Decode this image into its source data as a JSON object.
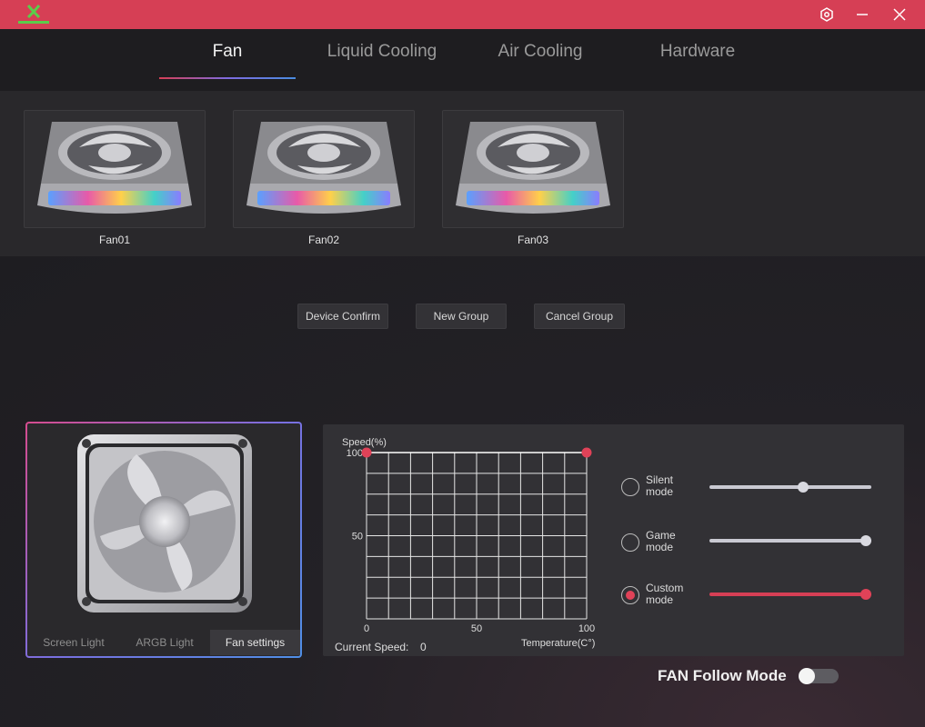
{
  "tabs": [
    {
      "label": "Fan",
      "active": true
    },
    {
      "label": "Liquid Cooling",
      "active": false
    },
    {
      "label": "Air Cooling",
      "active": false
    },
    {
      "label": "Hardware",
      "active": false
    }
  ],
  "devices": [
    {
      "label": "Fan01"
    },
    {
      "label": "Fan02"
    },
    {
      "label": "Fan03"
    }
  ],
  "buttons": {
    "device_confirm": "Device Confirm",
    "new_group": "New Group",
    "cancel_group": "Cancel Group"
  },
  "preview_tabs": [
    {
      "label": "Screen Light",
      "active": false
    },
    {
      "label": "ARGB Light",
      "active": false
    },
    {
      "label": "Fan settings",
      "active": true
    }
  ],
  "chart_data": {
    "type": "line",
    "ylabel": "Speed(%)",
    "xlabel": "Temperature(C°)",
    "x_ticks": [
      "0",
      "50",
      "100"
    ],
    "y_ticks": [
      "100",
      "50"
    ],
    "xlim": [
      0,
      100
    ],
    "ylim": [
      0,
      100
    ],
    "grid": true,
    "series": [
      {
        "points": [
          {
            "x": 0,
            "y": 100
          },
          {
            "x": 100,
            "y": 100
          }
        ]
      }
    ]
  },
  "current_speed": {
    "label": "Current Speed:",
    "value": "0"
  },
  "modes": [
    {
      "name": "Silent mode",
      "line1": "Silent",
      "line2": "mode",
      "checked": false,
      "level": 0.6
    },
    {
      "name": "Game mode",
      "line1": "Game",
      "line2": "mode",
      "checked": false,
      "level": 1.0
    },
    {
      "name": "Custom mode",
      "line1": "Custom",
      "line2": "mode",
      "checked": true,
      "level": 1.0
    }
  ],
  "fan_follow": {
    "label": "FAN Follow Mode",
    "enabled": false
  },
  "colors": {
    "accent": "#d63f55",
    "title_bar": "#d63f55"
  }
}
